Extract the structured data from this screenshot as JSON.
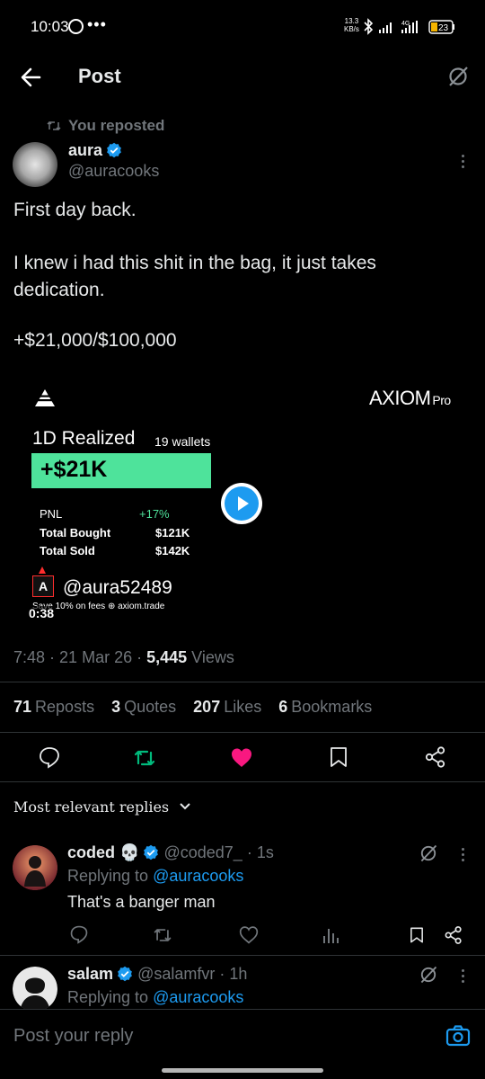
{
  "status_bar": {
    "time": "10:03",
    "more": "•••",
    "speed_value": "13.3",
    "speed_unit": "KB/s",
    "network": "4G",
    "battery": "23"
  },
  "header": {
    "title": "Post"
  },
  "post": {
    "reposted_label": "You reposted",
    "author_name": "aura",
    "author_handle": "@auracooks",
    "text_lines": [
      "First day back.",
      "I knew i had this shit in the bag, it just takes",
      "dedication.",
      "+$21,000/$100,000"
    ],
    "media": {
      "brand": "AXIOM",
      "brand_suffix": "Pro",
      "realized_label": "1D Realized",
      "wallets": "19 wallets",
      "pnl_value": "+$21K",
      "rows": [
        {
          "label": "PNL",
          "value": "+17%"
        },
        {
          "label": "Total Bought",
          "value": "$121K"
        },
        {
          "label": "Total Sold",
          "value": "$142K"
        }
      ],
      "avatar_letter": "A",
      "handle": "@aura52489",
      "footer": "Save 10% on fees  ⊕ axiom.trade",
      "duration": "0:38"
    },
    "time": "7:48",
    "date": "21 Mar 26",
    "views_count": "5,445",
    "views_label": "Views",
    "stats": {
      "reposts_count": "71",
      "reposts_label": "Reposts",
      "quotes_count": "3",
      "quotes_label": "Quotes",
      "likes_count": "207",
      "likes_label": "Likes",
      "bookmarks_count": "6",
      "bookmarks_label": "Bookmarks"
    }
  },
  "replies_section": {
    "sort_label": "Most relevant replies"
  },
  "replies": [
    {
      "name": "coded",
      "emoji": "💀",
      "handle": "@coded7_",
      "age": "1s",
      "replying_prefix": "Replying to",
      "replying_to": "@auracooks",
      "body": "That's a banger man"
    },
    {
      "name": "salam",
      "handle": "@salamfvr",
      "age": "1h",
      "replying_prefix": "Replying to",
      "replying_to": "@auracooks"
    }
  ],
  "compose": {
    "placeholder": "Post your reply"
  },
  "colors": {
    "background": "#000000",
    "accent_blue": "#1d9bf0",
    "like_pink": "#f91880",
    "repost_green": "#00ba7c",
    "axiom_green": "#4ee39b",
    "muted": "#71767b"
  }
}
